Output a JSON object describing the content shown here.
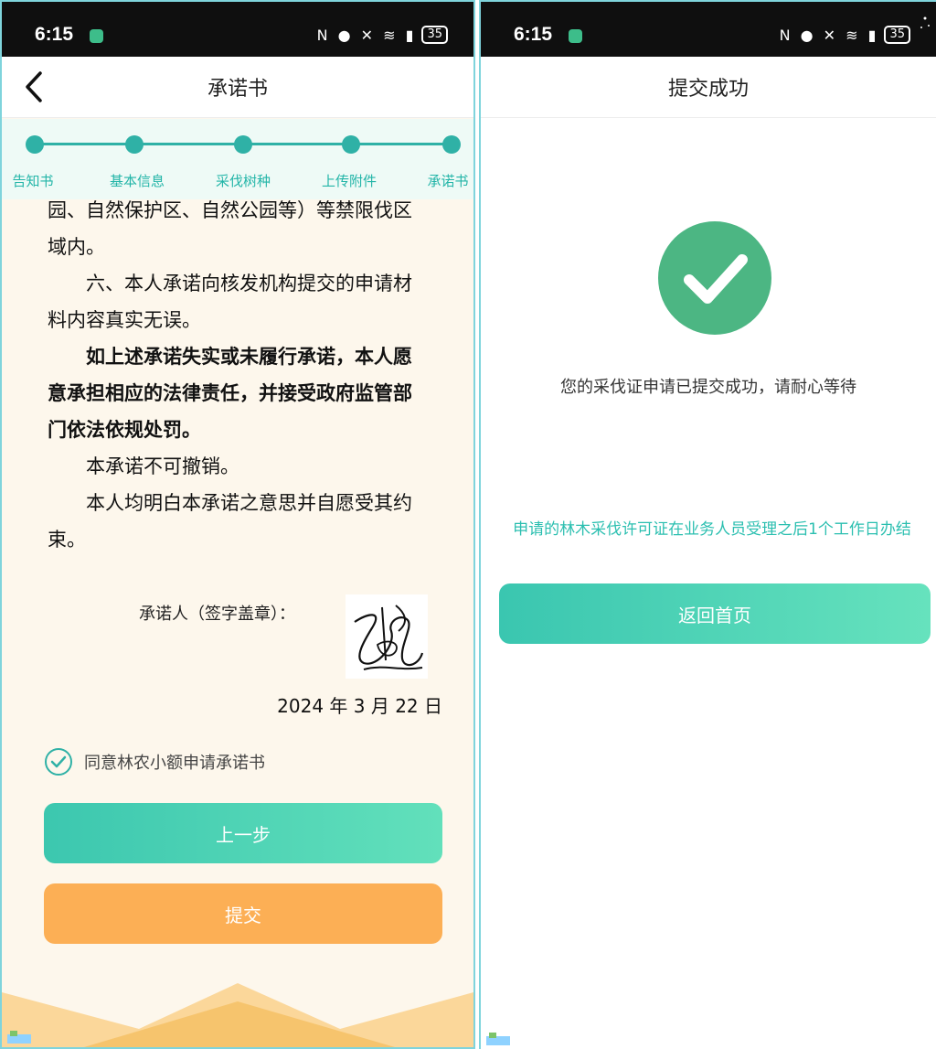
{
  "left": {
    "status": {
      "time": "6:15",
      "icons_text": "N ● ✕ ≋ ▮",
      "battery": "35"
    },
    "nav": {
      "title": "承诺书",
      "back_icon": "chevron-left-icon"
    },
    "steps": [
      "告知书",
      "基本信息",
      "采伐树种",
      "上传附件",
      "承诺书"
    ],
    "letter": {
      "paragraphs": [
        "园、自然保护区、自然公园等）等禁限伐区域内。",
        "六、本人承诺向核发机构提交的申请材料内容真实无误。",
        "如上述承诺失实或未履行承诺，本人愿意承担相应的法律责任，并接受政府监管部门依法依规处罚。",
        "本承诺不可撤销。",
        "本人均明白本承诺之意思并自愿受其约束。"
      ]
    },
    "signer_label": "承诺人（签字盖章）：",
    "date": "2024 年 3 月 22 日",
    "agree_text": "同意林农小额申请承诺书",
    "agree_checked": true,
    "prev_button": "上一步",
    "submit_button": "提交",
    "colors": {
      "accent": "#2fb1a6",
      "submit": "#fcaf55"
    }
  },
  "right": {
    "status": {
      "time": "6:15",
      "icons_text": "N ● ✕ ≋ ▮",
      "battery": "35"
    },
    "nav": {
      "title": "提交成功"
    },
    "success_message": "您的采伐证申请已提交成功，请耐心等待",
    "notice": "申请的林木采伐许可证在业务人员受理之后1个工作日办结",
    "home_button": "返回首页",
    "colors": {
      "success": "#4cb683",
      "notice": "#2bbfb0"
    }
  }
}
